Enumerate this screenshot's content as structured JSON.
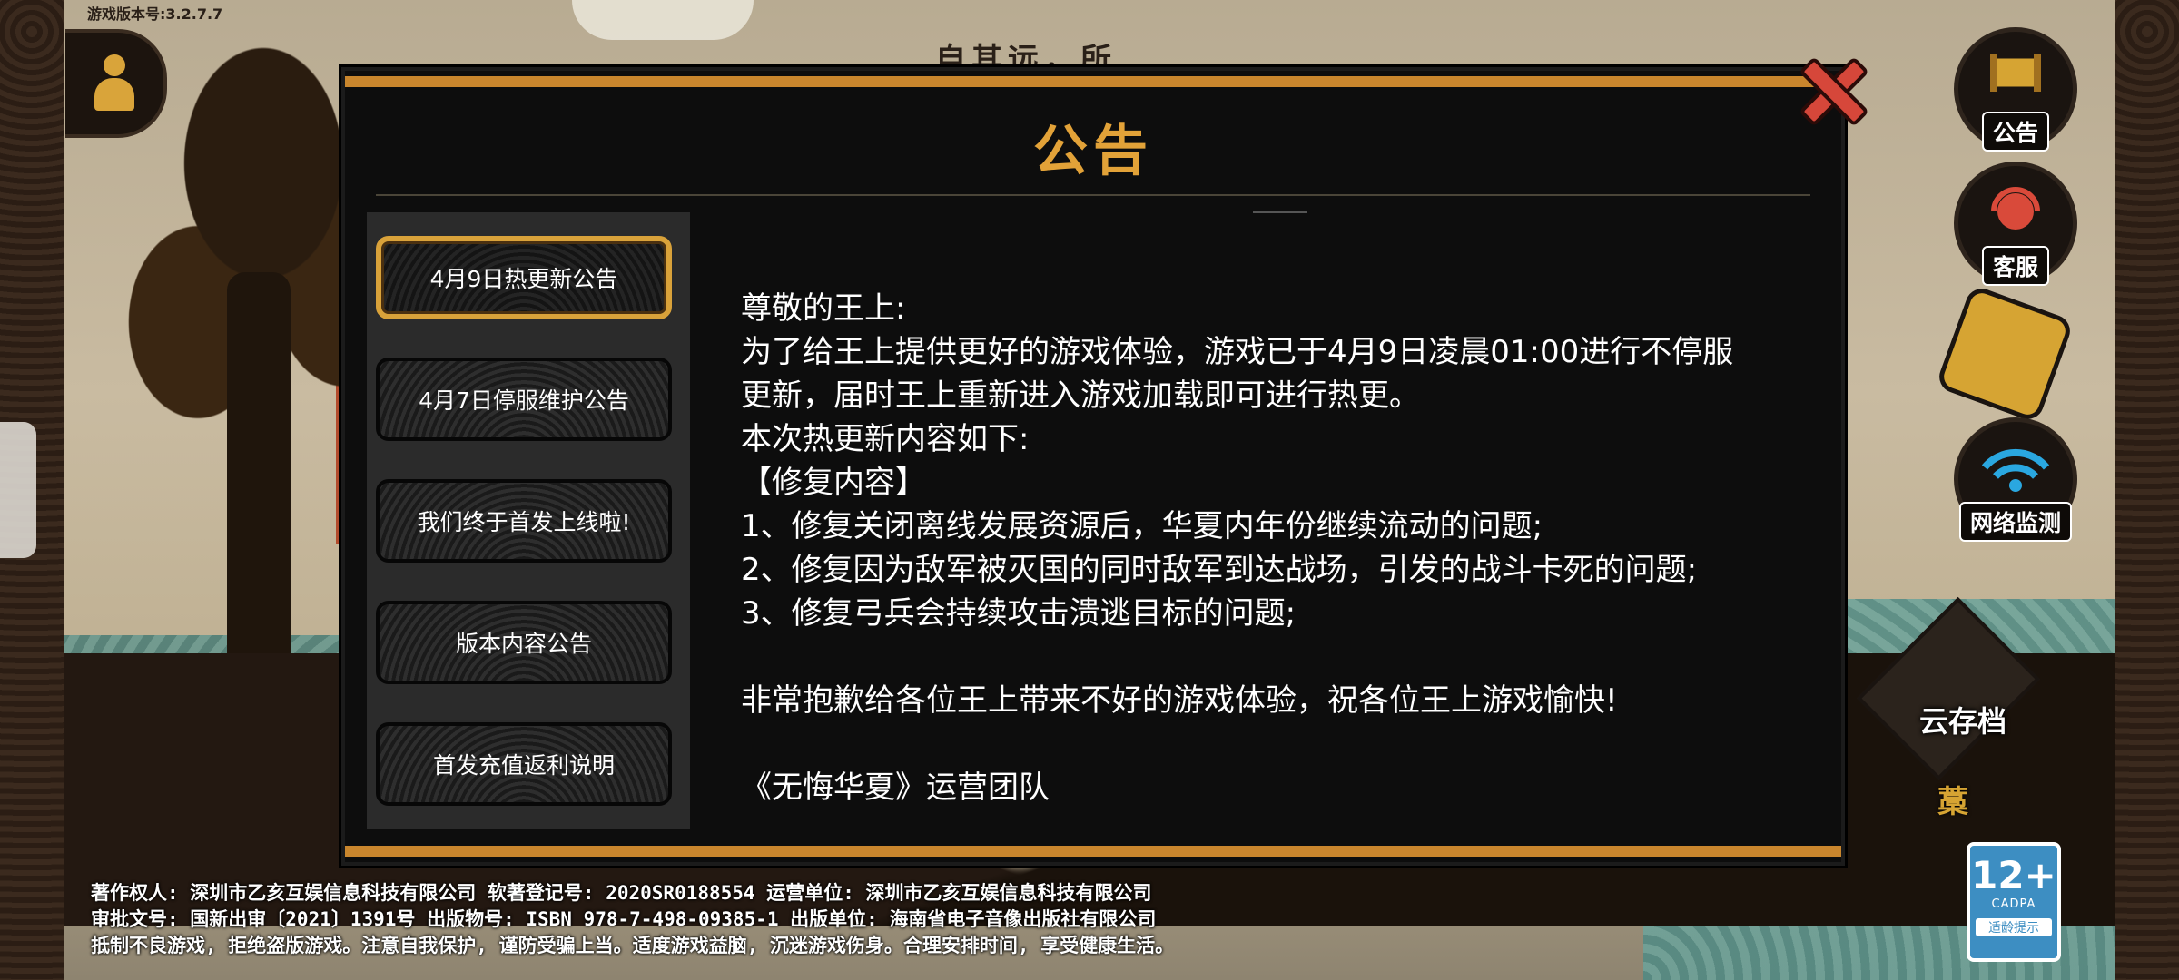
{
  "background": {
    "version_label": "游戏版本号:3.2.7.7",
    "title_text": "自其远，所"
  },
  "side_buttons": {
    "announcement": "公告",
    "service": "客服",
    "network": "网络监测",
    "save": "云存档",
    "save_sub": "藁"
  },
  "age_rating": {
    "number": "12+",
    "org": "CADPA",
    "tip": "适龄提示"
  },
  "dialog": {
    "title": "公告",
    "tabs": [
      {
        "label": "4月9日热更新公告",
        "active": true
      },
      {
        "label": "4月7日停服维护公告",
        "active": false
      },
      {
        "label": "我们终于首发上线啦!",
        "active": false
      },
      {
        "label": "版本内容公告",
        "active": false
      },
      {
        "label": "首发充值返利说明",
        "active": false
      }
    ],
    "content": [
      "尊敬的王上:",
      "为了给王上提供更好的游戏体验，游戏已于4月9日凌晨01:00进行不停服",
      "更新，届时王上重新进入游戏加载即可进行热更。",
      "本次热更新内容如下:",
      "【修复内容】",
      "1、修复关闭离线发展资源后，华夏内年份继续流动的问题;",
      "2、修复因为敌军被灭国的同时敌军到达战场，引发的战斗卡死的问题;",
      "3、修复弓兵会持续攻击溃逃目标的问题;",
      "",
      "非常抱歉给各位王上带来不好的游戏体验，祝各位王上游戏愉快!",
      "",
      "《无悔华夏》运营团队"
    ]
  },
  "footer": {
    "line1": "著作权人: 深圳市乙亥互娱信息科技有限公司 软著登记号: 2020SR0188554  运营单位: 深圳市乙亥互娱信息科技有限公司",
    "line2": "审批文号: 国新出审〔2021〕1391号   出版物号: ISBN 978-7-498-09385-1  出版单位: 海南省电子音像出版社有限公司",
    "line3": "抵制不良游戏, 拒绝盗版游戏。注意自我保护, 谨防受骗上当。适度游戏益脑, 沉迷游戏伤身。合理安排时间, 享受健康生活。"
  },
  "colors": {
    "accent_gold": "#e2a238",
    "close_red": "#d6473a",
    "dialog_bg": "#0d0d0d"
  }
}
